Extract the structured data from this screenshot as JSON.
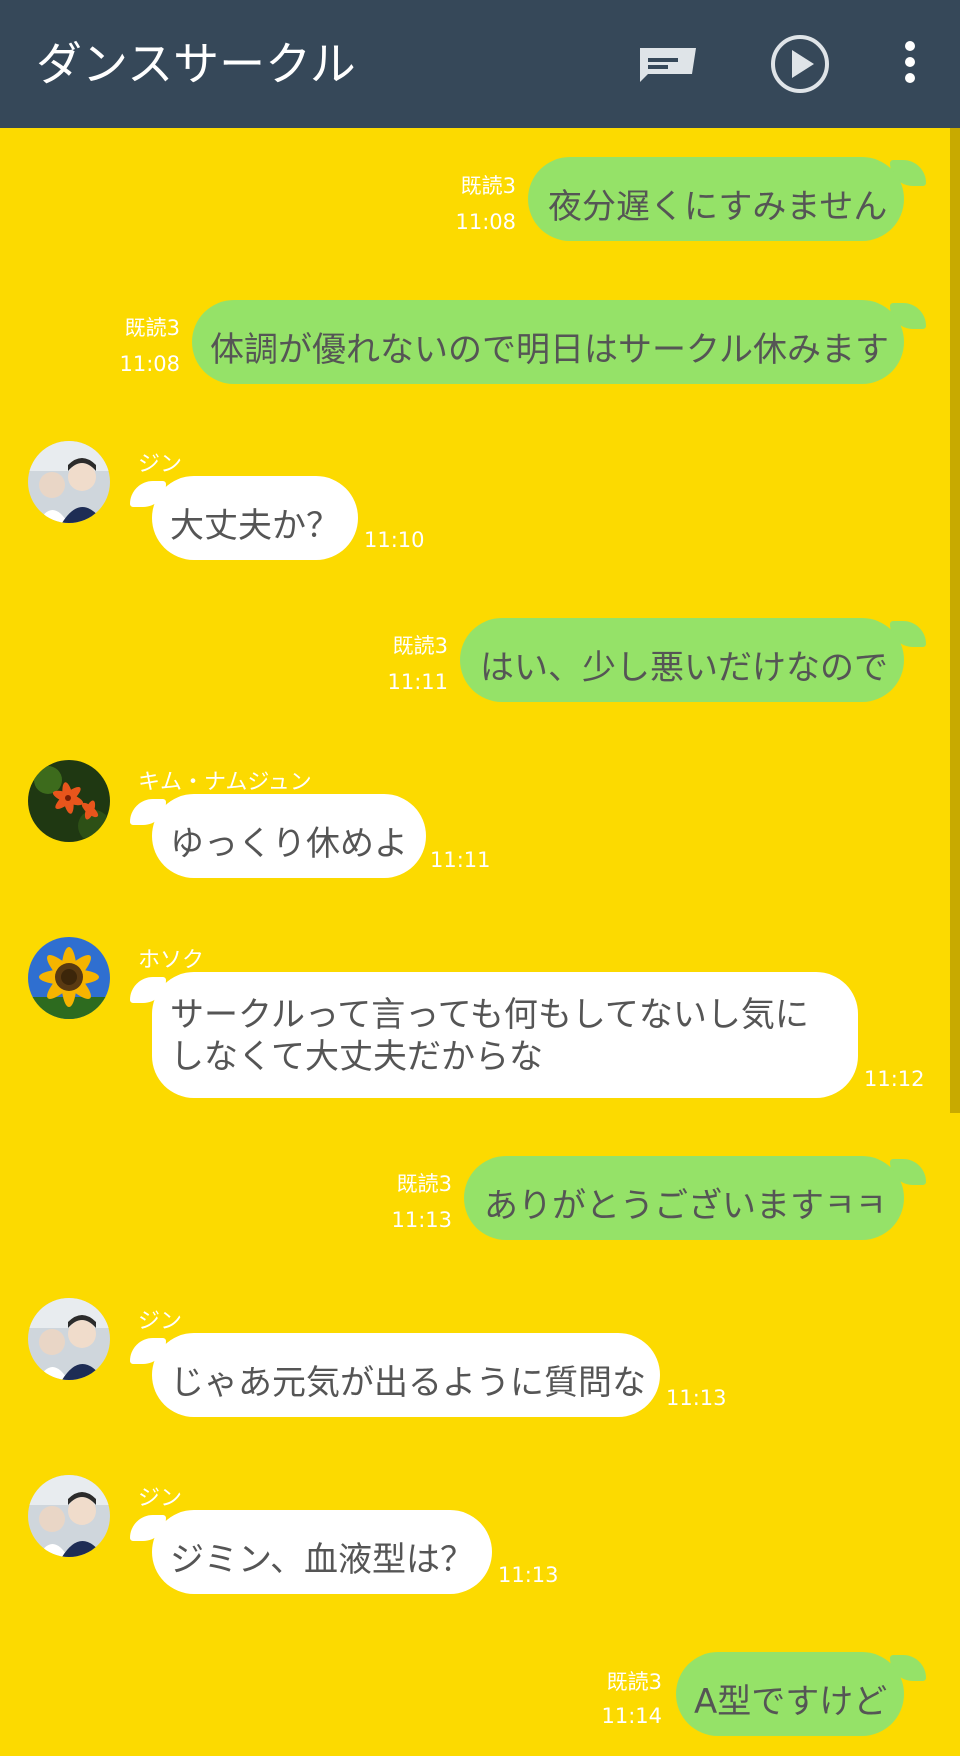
{
  "header": {
    "title": "ダンスサークル",
    "icons": [
      "message-icon",
      "play-icon",
      "more-vertical-icon"
    ]
  },
  "colors": {
    "background": "#fcda00",
    "header": "#364859",
    "outgoing_bubble": "#95e268",
    "incoming_bubble": "#ffffff"
  },
  "messages": [
    {
      "direction": "out",
      "text": "夜分遅くにすみません",
      "read": "既読3",
      "time": "11:08"
    },
    {
      "direction": "out",
      "text": "体調が優れないので明日はサークル休みます",
      "read": "既読3",
      "time": "11:08"
    },
    {
      "direction": "in",
      "sender": "ジン",
      "avatar": "photo-avatar",
      "text": "大丈夫か？",
      "time": "11:10"
    },
    {
      "direction": "out",
      "text": "はい、少し悪いだけなので",
      "read": "既読3",
      "time": "11:11"
    },
    {
      "direction": "in",
      "sender": "キム・ナムジュン",
      "avatar": "lily-flower-avatar",
      "text": "ゆっくり休めよ",
      "time": "11:11"
    },
    {
      "direction": "in",
      "sender": "ホソク",
      "avatar": "sunflower-avatar",
      "text_line1": "サークルって言っても何もしてないし気に",
      "text_line2": "しなくて大丈夫だからな",
      "time": "11:12"
    },
    {
      "direction": "out",
      "text": "ありがとうございますㅋㅋ",
      "read": "既読3",
      "time": "11:13"
    },
    {
      "direction": "in",
      "sender": "ジン",
      "avatar": "photo-avatar",
      "text": "じゃあ元気が出るように質問な",
      "time": "11:13"
    },
    {
      "direction": "in",
      "sender": "ジン",
      "avatar": "photo-avatar",
      "text": "ジミン、血液型は？",
      "time": "11:13"
    },
    {
      "direction": "out",
      "text": "A型ですけど",
      "read": "既読3",
      "time": "11:14"
    }
  ]
}
